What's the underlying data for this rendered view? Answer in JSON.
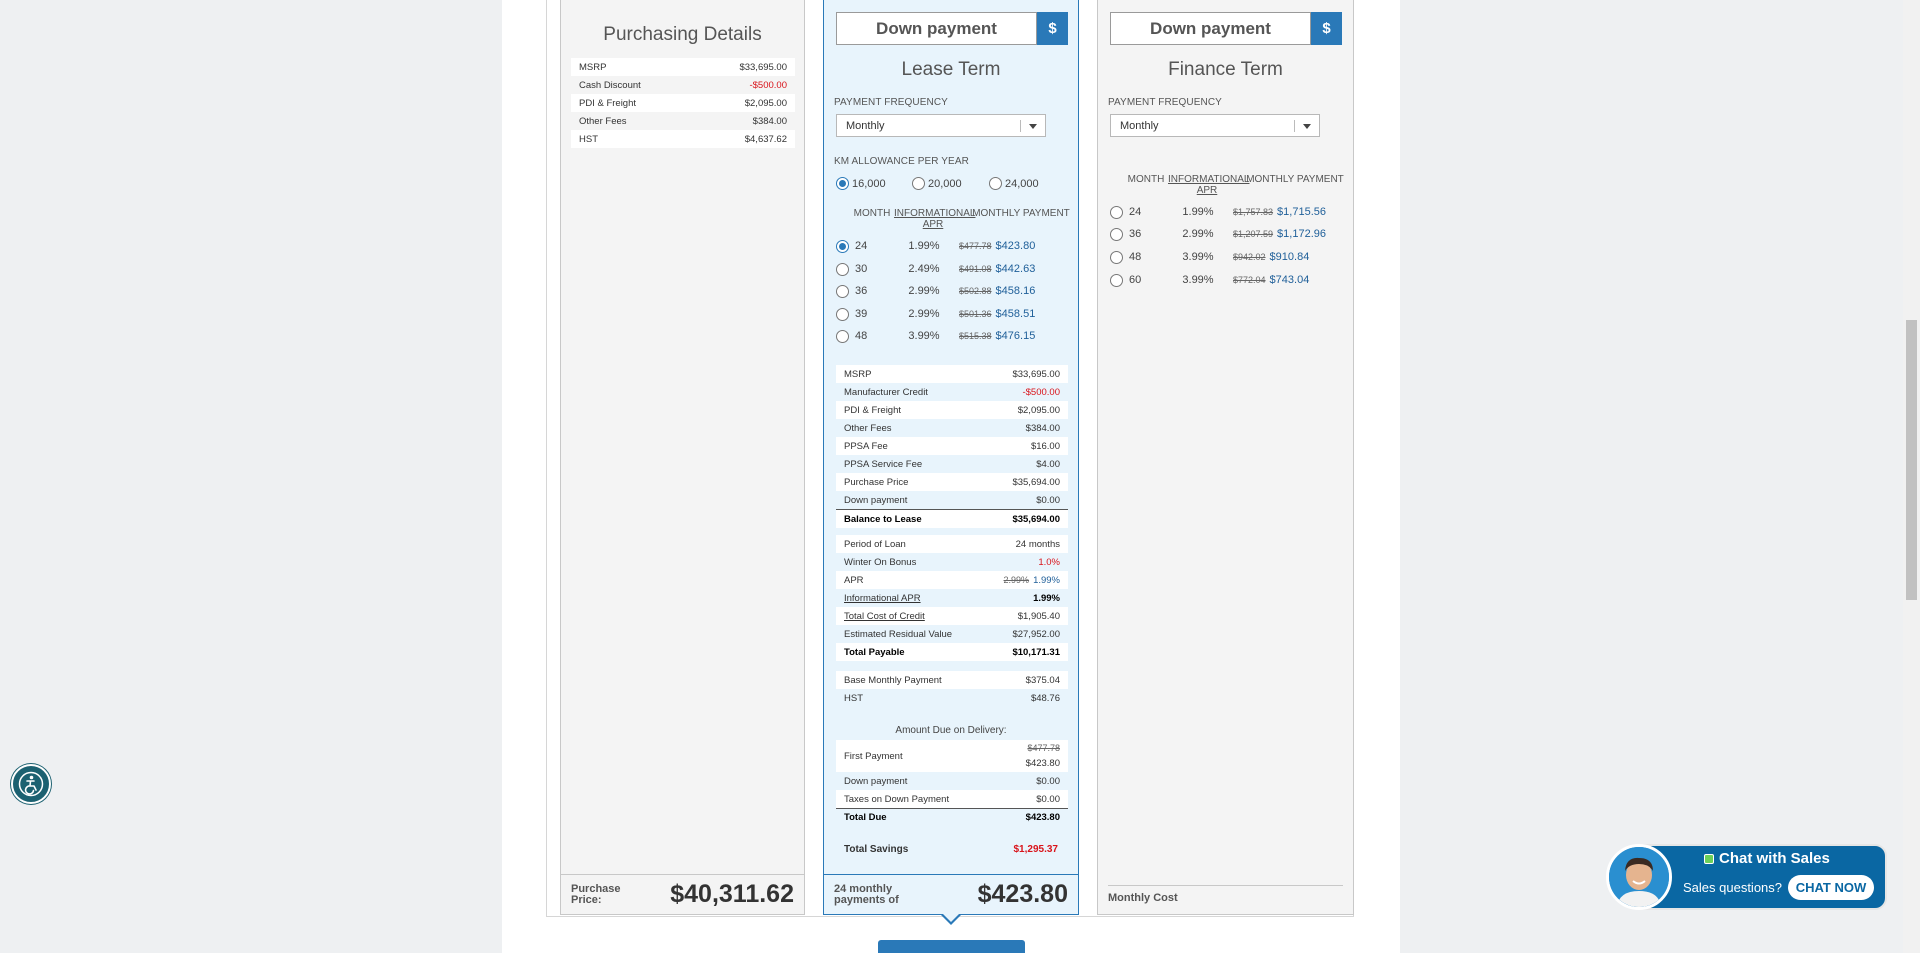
{
  "purchasing": {
    "title": "Purchasing Details",
    "rows": [
      {
        "k": "MSRP",
        "v": "$33,695.00"
      },
      {
        "k": "Cash Discount",
        "v": "-$500.00"
      },
      {
        "k": "PDI & Freight",
        "v": "$2,095.00"
      },
      {
        "k": "Other Fees",
        "v": "$384.00"
      },
      {
        "k": "HST",
        "v": "$4,637.62"
      }
    ],
    "footer_label": "Purchase Price:",
    "footer_l1": "Purchase",
    "footer_l2": "Price:",
    "footer_value": "$40,311.62"
  },
  "lease": {
    "down_payment_label": "Down payment",
    "currency_btn": "$",
    "title": "Lease Term",
    "freq_label": "PAYMENT FREQUENCY",
    "freq_value": "Monthly",
    "km_label": "KM ALLOWANCE PER YEAR",
    "km_options": [
      "16,000",
      "20,000",
      "24,000"
    ],
    "head": {
      "month": "MONTH",
      "apr1": "INFORMATIONAL",
      "apr2": "APR",
      "payment": "MONTHLY PAYMENT"
    },
    "terms": [
      {
        "m": "24",
        "a": "1.99%",
        "old": "$477.78",
        "new": "$423.80"
      },
      {
        "m": "30",
        "a": "2.49%",
        "old": "$491.08",
        "new": "$442.63"
      },
      {
        "m": "36",
        "a": "2.99%",
        "old": "$502.88",
        "new": "$458.16"
      },
      {
        "m": "39",
        "a": "2.99%",
        "old": "$501.36",
        "new": "$458.51"
      },
      {
        "m": "48",
        "a": "3.99%",
        "old": "$515.38",
        "new": "$476.15"
      }
    ],
    "details": [
      {
        "k": "MSRP",
        "v": "$33,695.00"
      },
      {
        "k": "Manufacturer Credit",
        "v": "-$500.00"
      },
      {
        "k": "PDI & Freight",
        "v": "$2,095.00"
      },
      {
        "k": "Other Fees",
        "v": "$384.00"
      },
      {
        "k": "PPSA Fee",
        "v": "$16.00"
      },
      {
        "k": "PPSA Service Fee",
        "v": "$4.00"
      },
      {
        "k": "Purchase Price",
        "v": "$35,694.00"
      },
      {
        "k": "Down payment",
        "v": "$0.00"
      }
    ],
    "balance": {
      "k": "Balance to Lease",
      "v": "$35,694.00"
    },
    "loan": {
      "period_k": "Period of Loan",
      "period_v": "24 months",
      "bonus_k": "Winter On Bonus",
      "bonus_v": "1.0%",
      "apr_k": "APR",
      "apr_old": "2.99%",
      "apr_new": "1.99%",
      "iapr_k": "Informational APR",
      "iapr_v": "1.99%",
      "tcc_k": "Total Cost of Credit",
      "tcc_v": "$1,905.40",
      "resid_k": "Estimated Residual Value",
      "resid_v": "$27,952.00",
      "payable_k": "Total Payable",
      "payable_v": "$10,171.31"
    },
    "monthly": {
      "base_k": "Base Monthly Payment",
      "base_v": "$375.04",
      "hst_k": "HST",
      "hst_v": "$48.76"
    },
    "due": {
      "title": "Amount Due on Delivery:",
      "first_k": "First Payment",
      "first_old": "$477.78",
      "first_new": "$423.80",
      "dp_k": "Down payment",
      "dp_v": "$0.00",
      "tax_k": "Taxes on Down Payment",
      "tax_v": "$0.00",
      "total_k": "Total Due",
      "total_v": "$423.80"
    },
    "savings_k": "Total Savings",
    "savings_v": "$1,295.37",
    "footer_l1": "24 monthly",
    "footer_l2": "payments of",
    "footer_value": "$423.80"
  },
  "finance": {
    "down_payment_label": "Down payment",
    "currency_btn": "$",
    "title": "Finance Term",
    "freq_label": "PAYMENT FREQUENCY",
    "freq_value": "Monthly",
    "head": {
      "month": "MONTH",
      "apr1": "INFORMATIONAL",
      "apr2": "APR",
      "payment": "MONTHLY PAYMENT"
    },
    "terms": [
      {
        "m": "24",
        "a": "1.99%",
        "old": "$1,757.83",
        "new": "$1,715.56"
      },
      {
        "m": "36",
        "a": "2.99%",
        "old": "$1,207.59",
        "new": "$1,172.96"
      },
      {
        "m": "48",
        "a": "3.99%",
        "old": "$942.02",
        "new": "$910.84"
      },
      {
        "m": "60",
        "a": "3.99%",
        "old": "$772.04",
        "new": "$743.04"
      }
    ],
    "footer_label": "Monthly Cost"
  },
  "chat": {
    "title": "Chat with Sales",
    "subtitle": "Sales questions?",
    "button": "CHAT NOW"
  },
  "icons": {
    "accessibility": "accessibility-icon",
    "avatar": "agent-avatar"
  },
  "colors": {
    "accent": "#2a79b8",
    "red": "#d9141b",
    "chat": "#0a67a3"
  }
}
